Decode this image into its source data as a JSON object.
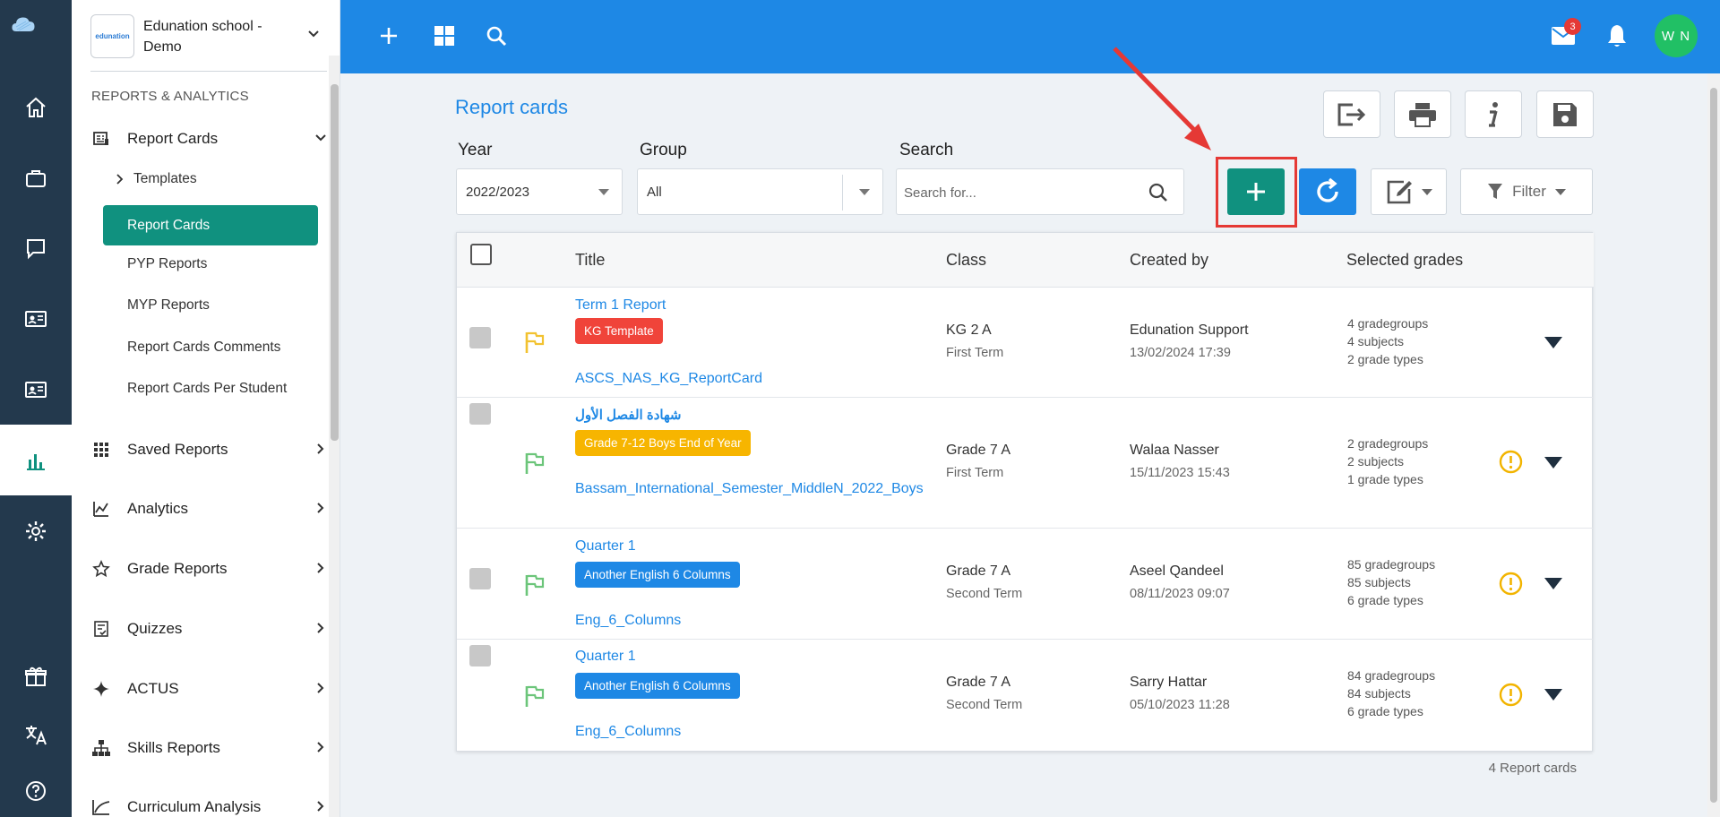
{
  "school": {
    "name": "Edunation school - Demo",
    "logo_text": "edunation"
  },
  "sidebar": {
    "section_title": "REPORTS & ANALYTICS",
    "report_cards": {
      "label": "Report Cards",
      "children": [
        {
          "label": "Templates"
        },
        {
          "label": "Report Cards"
        },
        {
          "label": "PYP Reports"
        },
        {
          "label": "MYP Reports"
        },
        {
          "label": "Report Cards Comments"
        },
        {
          "label": "Report Cards Per Student"
        }
      ]
    },
    "items": [
      {
        "label": "Saved Reports",
        "icon": "grid-icon"
      },
      {
        "label": "Analytics",
        "icon": "analytics-icon"
      },
      {
        "label": "Grade Reports",
        "icon": "star-icon"
      },
      {
        "label": "Quizzes",
        "icon": "quiz-icon"
      },
      {
        "label": "ACTUS",
        "icon": "sparkle-icon"
      },
      {
        "label": "Skills Reports",
        "icon": "hierarchy-icon"
      },
      {
        "label": "Curriculum Analysis",
        "icon": "line-chart-icon"
      }
    ]
  },
  "topbar": {
    "mail_badge": "3",
    "avatar_initials": "W N"
  },
  "page": {
    "title": "Report cards",
    "filters": {
      "year_label": "Year",
      "year_value": "2022/2023",
      "group_label": "Group",
      "group_value": "All",
      "search_label": "Search",
      "search_placeholder": "Search for..."
    },
    "filter_button": "Filter",
    "count_text": "4 Report cards"
  },
  "table": {
    "headers": {
      "title": "Title",
      "class": "Class",
      "created_by": "Created by",
      "grades": "Selected grades"
    },
    "rows": [
      {
        "title": "Term 1 Report",
        "tag": "KG Template",
        "template": "ASCS_NAS_KG_ReportCard",
        "class": "KG 2 A",
        "term": "First Term",
        "created_by": "Edunation Support",
        "date": "13/02/2024 17:39",
        "gradegroups": "4 gradegroups",
        "subjects": "4 subjects",
        "grade_types": "2 grade types"
      },
      {
        "title": "شهادة الفصل الأول",
        "tag": "Grade 7-12 Boys End of Year",
        "template": "Bassam_International_Semester_MiddleN_2022_Boys",
        "class": "Grade 7 A",
        "term": "First Term",
        "created_by": "Walaa Nasser",
        "date": "15/11/2023 15:43",
        "gradegroups": "2 gradegroups",
        "subjects": "2 subjects",
        "grade_types": "1 grade types"
      },
      {
        "title": "Quarter 1",
        "tag": "Another English 6 Columns",
        "template": "Eng_6_Columns",
        "class": "Grade 7 A",
        "term": "Second Term",
        "created_by": "Aseel Qandeel",
        "date": "08/11/2023 09:07",
        "gradegroups": "85 gradegroups",
        "subjects": "85 subjects",
        "grade_types": "6 grade types"
      },
      {
        "title": "Quarter 1",
        "tag": "Another English 6 Columns",
        "template": "Eng_6_Columns",
        "class": "Grade 7 A",
        "term": "Second Term",
        "created_by": "Sarry Hattar",
        "date": "05/10/2023 11:28",
        "gradegroups": "84 gradegroups",
        "subjects": "84 subjects",
        "grade_types": "6 grade types"
      }
    ]
  },
  "colors": {
    "primary": "#1e88e5",
    "teal": "#10917f",
    "rail": "#23394d",
    "tag_red": "#f0443a",
    "tag_amber": "#f7b500",
    "tag_blue": "#1e88e5",
    "highlight": "#e53935"
  }
}
